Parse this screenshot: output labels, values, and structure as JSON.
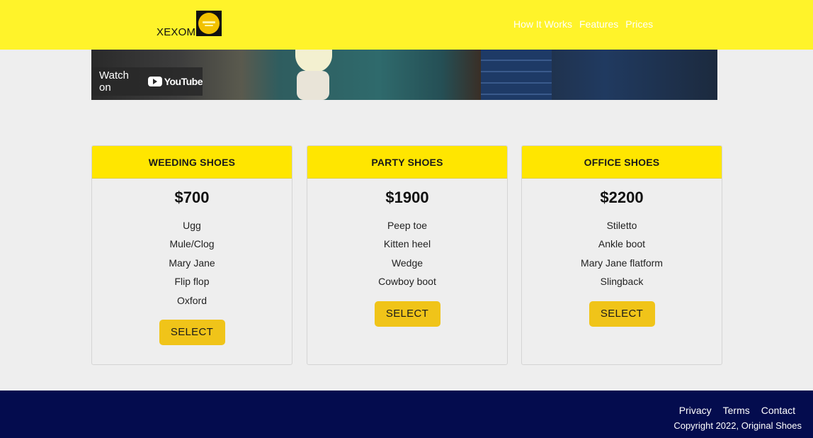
{
  "header": {
    "brand": "XEXOM",
    "nav": [
      "How It Works",
      "Features",
      "Prices"
    ]
  },
  "video": {
    "watch_label": "Watch on",
    "youtube_label": "YouTube"
  },
  "plans": [
    {
      "title": "WEEDING SHOES",
      "price": "$700",
      "items": [
        "Ugg",
        "Mule/Clog",
        "Mary Jane",
        "Flip flop",
        "Oxford"
      ],
      "button": "SELECT"
    },
    {
      "title": "PARTY SHOES",
      "price": "$1900",
      "items": [
        "Peep toe",
        "Kitten heel",
        "Wedge",
        "Cowboy boot"
      ],
      "button": "SELECT"
    },
    {
      "title": "OFFICE SHOES",
      "price": "$2200",
      "items": [
        "Stiletto",
        "Ankle boot",
        "Mary Jane flatform",
        "Slingback"
      ],
      "button": "SELECT"
    }
  ],
  "footer": {
    "links": [
      "Privacy",
      "Terms",
      "Contact"
    ],
    "copyright": "Copyright 2022, Original Shoes"
  },
  "colors": {
    "header_bg": "#fff32a",
    "card_head_bg": "#ffe600",
    "button_bg": "#f0c419",
    "footer_bg": "#040c4e",
    "page_bg": "#eeeeee"
  }
}
